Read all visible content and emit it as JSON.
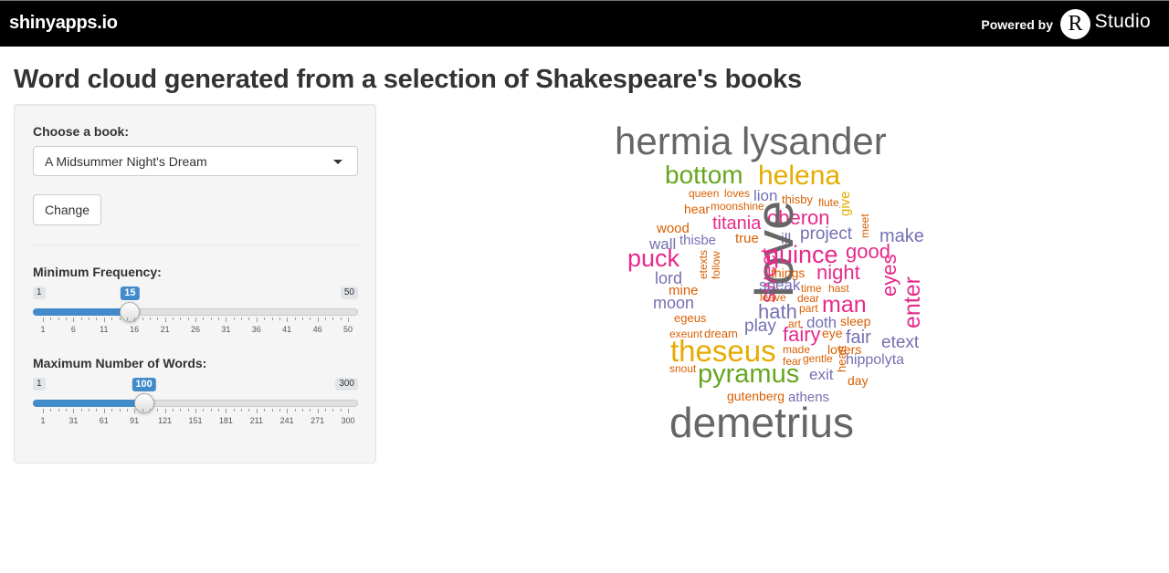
{
  "header": {
    "brand": "shinyapps.io",
    "powered_by": "Powered by",
    "r_logo": "R",
    "studio": "Studio"
  },
  "page_title": "Word cloud generated from a selection of Shakespeare's books",
  "sidebar": {
    "book_label": "Choose a book:",
    "book_selected": "A Midsummer Night's Dream",
    "change_button": "Change",
    "min_freq": {
      "label": "Minimum Frequency:",
      "min": 1,
      "max": 50,
      "value": 15,
      "min_text": "1",
      "max_text": "50",
      "value_text": "15",
      "grid_labels": [
        "1",
        "6",
        "11",
        "16",
        "21",
        "26",
        "31",
        "36",
        "41",
        "46",
        "50"
      ]
    },
    "max_words": {
      "label": "Maximum Number of Words:",
      "min": 1,
      "max": 300,
      "value": 100,
      "min_text": "1",
      "max_text": "300",
      "value_text": "100",
      "grid_labels": [
        "1",
        "31",
        "61",
        "91",
        "121",
        "151",
        "181",
        "211",
        "241",
        "271",
        "300"
      ]
    }
  },
  "colors": {
    "gray": "#666666",
    "green": "#66a61e",
    "gold": "#e6ab02",
    "pink": "#e7298a",
    "purple": "#7570b3",
    "orange": "#d95f02",
    "accent": "#428bca"
  },
  "word_cloud": [
    {
      "text": "hermia",
      "color": "gray"
    },
    {
      "text": "lysander",
      "color": "gray"
    },
    {
      "text": "bottom",
      "color": "green"
    },
    {
      "text": "helena",
      "color": "gold"
    },
    {
      "text": "queen",
      "color": "orange"
    },
    {
      "text": "loves",
      "color": "orange"
    },
    {
      "text": "lion",
      "color": "purple"
    },
    {
      "text": "thisby",
      "color": "orange"
    },
    {
      "text": "flute",
      "color": "orange"
    },
    {
      "text": "give",
      "color": "gold"
    },
    {
      "text": "hear",
      "color": "orange"
    },
    {
      "text": "moonshine",
      "color": "orange"
    },
    {
      "text": "titania",
      "color": "pink"
    },
    {
      "text": "oberon",
      "color": "pink"
    },
    {
      "text": "meet",
      "color": "orange"
    },
    {
      "text": "wood",
      "color": "orange"
    },
    {
      "text": "wall",
      "color": "purple"
    },
    {
      "text": "thisbe",
      "color": "purple"
    },
    {
      "text": "true",
      "color": "orange"
    },
    {
      "text": "ill",
      "color": "purple"
    },
    {
      "text": "project",
      "color": "purple"
    },
    {
      "text": "make",
      "color": "purple"
    },
    {
      "text": "puck",
      "color": "pink"
    },
    {
      "text": "love",
      "color": "gray"
    },
    {
      "text": "sweet",
      "color": "pink"
    },
    {
      "text": "quince",
      "color": "pink"
    },
    {
      "text": "good",
      "color": "pink"
    },
    {
      "text": "etexts",
      "color": "orange"
    },
    {
      "text": "follow",
      "color": "orange"
    },
    {
      "text": "lord",
      "color": "purple"
    },
    {
      "text": "things",
      "color": "orange"
    },
    {
      "text": "night",
      "color": "pink"
    },
    {
      "text": "mine",
      "color": "orange"
    },
    {
      "text": "speak",
      "color": "purple"
    },
    {
      "text": "time",
      "color": "orange"
    },
    {
      "text": "hast",
      "color": "orange"
    },
    {
      "text": "eyes",
      "color": "pink"
    },
    {
      "text": "enter",
      "color": "pink"
    },
    {
      "text": "moon",
      "color": "purple"
    },
    {
      "text": "leave",
      "color": "orange"
    },
    {
      "text": "dear",
      "color": "orange"
    },
    {
      "text": "man",
      "color": "pink"
    },
    {
      "text": "hath",
      "color": "purple"
    },
    {
      "text": "part",
      "color": "orange"
    },
    {
      "text": "egeus",
      "color": "orange"
    },
    {
      "text": "play",
      "color": "purple"
    },
    {
      "text": "art",
      "color": "orange"
    },
    {
      "text": "doth",
      "color": "purple"
    },
    {
      "text": "sleep",
      "color": "orange"
    },
    {
      "text": "exeunt",
      "color": "orange"
    },
    {
      "text": "dream",
      "color": "orange"
    },
    {
      "text": "fairy",
      "color": "pink"
    },
    {
      "text": "eye",
      "color": "orange"
    },
    {
      "text": "fair",
      "color": "purple"
    },
    {
      "text": "etext",
      "color": "purple"
    },
    {
      "text": "theseus",
      "color": "gold"
    },
    {
      "text": "made",
      "color": "orange"
    },
    {
      "text": "lovers",
      "color": "orange"
    },
    {
      "text": "fear",
      "color": "orange"
    },
    {
      "text": "gentle",
      "color": "orange"
    },
    {
      "text": "hippolyta",
      "color": "purple"
    },
    {
      "text": "snout",
      "color": "orange"
    },
    {
      "text": "pyramus",
      "color": "green"
    },
    {
      "text": "exit",
      "color": "purple"
    },
    {
      "text": "heart",
      "color": "orange"
    },
    {
      "text": "day",
      "color": "orange"
    },
    {
      "text": "gutenberg",
      "color": "orange"
    },
    {
      "text": "athens",
      "color": "purple"
    },
    {
      "text": "demetrius",
      "color": "gray"
    }
  ]
}
